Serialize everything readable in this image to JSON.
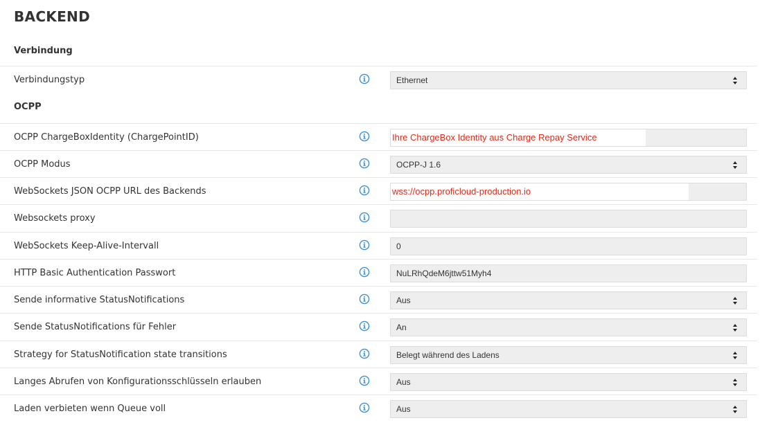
{
  "title": "BACKEND",
  "sections": {
    "verbindung": "Verbindung",
    "ocpp": "OCPP"
  },
  "rows": [
    {
      "label": "Verbindungstyp",
      "value": "Ethernet",
      "control": "select"
    },
    {
      "label": "OCPP ChargeBoxIdentity (ChargePointID)",
      "value": "Ihre ChargeBox Identity aus Charge Repay Service",
      "control": "input-highlight"
    },
    {
      "label": "OCPP Modus",
      "value": "OCPP-J 1.6",
      "control": "select"
    },
    {
      "label": "WebSockets JSON OCPP URL des Backends",
      "value": "wss://ocpp.proficloud-production.io",
      "control": "input-highlight"
    },
    {
      "label": "Websockets proxy",
      "value": "",
      "control": "input"
    },
    {
      "label": "WebSockets Keep-Alive-Intervall",
      "value": "0",
      "control": "input"
    },
    {
      "label": "HTTP Basic Authentication Passwort",
      "value": "NuLRhQdeM6jttw51Myh4",
      "control": "input"
    },
    {
      "label": "Sende informative StatusNotifications",
      "value": "Aus",
      "control": "select"
    },
    {
      "label": "Sende StatusNotifications für Fehler",
      "value": "An",
      "control": "select"
    },
    {
      "label": "Strategy for StatusNotification state transitions",
      "value": "Belegt während des Ladens",
      "control": "select"
    },
    {
      "label": "Langes Abrufen von Konfigurationsschlüsseln erlauben",
      "value": "Aus",
      "control": "select"
    },
    {
      "label": "Laden verbieten wenn Queue voll",
      "value": "Aus",
      "control": "select"
    }
  ],
  "icons": {
    "info": "info-circle-icon",
    "caret": "select-caret-icon"
  },
  "colors": {
    "info_icon": "#3a8fd9",
    "highlight_text": "#e02a1a",
    "field_bg": "#eeeeee"
  }
}
